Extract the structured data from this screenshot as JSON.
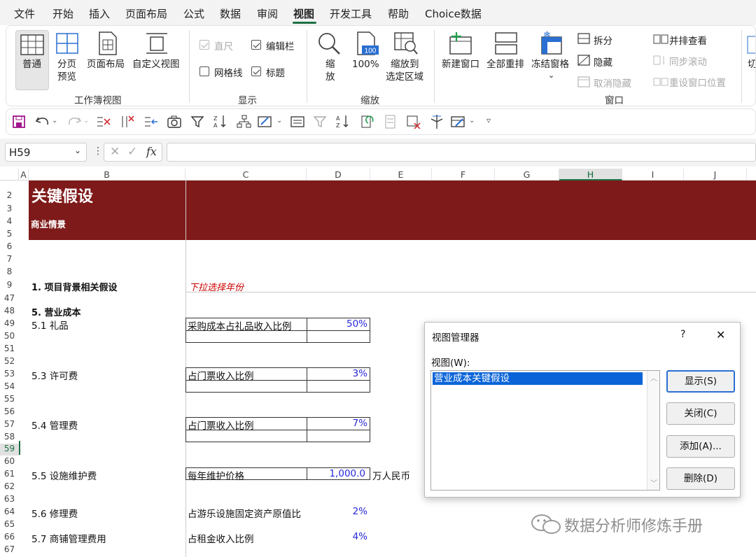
{
  "menu": [
    "文件",
    "开始",
    "插入",
    "页面布局",
    "公式",
    "数据",
    "审阅",
    "视图",
    "开发工具",
    "帮助",
    "Choice数据"
  ],
  "menu_active": "视图",
  "ribbon": {
    "workbook_views": {
      "normal": "普通",
      "page_break_1": "分页",
      "page_break_2": "预览",
      "page_layout": "页面布局",
      "custom_views": "自定义视图",
      "group": "工作簿视图"
    },
    "show": {
      "ruler": "直尺",
      "formula_bar": "编辑栏",
      "gridlines": "网格线",
      "headings": "标题",
      "group": "显示"
    },
    "zoom": {
      "zoom_1": "缩",
      "zoom_2": "放",
      "hundred": "100%",
      "zoom_sel_1": "缩放到",
      "zoom_sel_2": "选定区域",
      "group": "缩放",
      "icon_100": "100"
    },
    "window": {
      "new_window": "新建窗口",
      "arrange_all": "全部重排",
      "freeze_panes": "冻结窗格",
      "split": "拆分",
      "hide": "隐藏",
      "unhide": "取消隐藏",
      "side_by_side": "并排查看",
      "sync_scroll": "同步滚动",
      "reset_pos": "重设窗口位置",
      "group": "窗口",
      "switch": "切"
    }
  },
  "formula_bar": {
    "name_box": "H59",
    "fx": "fx",
    "value": ""
  },
  "columns": [
    "A",
    "B",
    "C",
    "D",
    "E",
    "F",
    "G",
    "H",
    "I",
    "J"
  ],
  "selected_column": "H",
  "rows": [
    "2",
    "3",
    "4",
    "5",
    "6",
    "7",
    "8",
    "9",
    "47",
    "48",
    "49",
    "50",
    "51",
    "52",
    "53",
    "54",
    "55",
    "56",
    "57",
    "58",
    "59",
    "60",
    "61",
    "62",
    "63",
    "64",
    "65",
    "66",
    "67"
  ],
  "selected_row": "59",
  "sheet": {
    "title": "关键假设",
    "subtitle": "商业情景",
    "sec1": "1. 项目背景相关假设",
    "dropdown_hint": "下拉选择年份",
    "sec5": "5. 营业成本",
    "gift": "5.1 礼品",
    "gift_label": "采购成本占礼品收入比例",
    "gift_value": "50%",
    "license": "5.3 许可费",
    "license_label": "占门票收入比例",
    "license_value": "3%",
    "mgmt": "5.4 管理费",
    "mgmt_label": "占门票收入比例",
    "mgmt_value": "7%",
    "maint": "5.5 设施维护费",
    "maint_label": "每年维护价格",
    "maint_value": "1,000.0",
    "maint_unit": "万人民币",
    "repair": "5.6 修理费",
    "repair_label": "占游乐设施固定资产原值比",
    "repair_value": "2%",
    "shop": "5.7 商铺管理费用",
    "shop_label": "占租金收入比例",
    "shop_value": "4%"
  },
  "dialog": {
    "title": "视图管理器",
    "help": "?",
    "close": "✕",
    "list_label": "视图(W):",
    "items": [
      "营业成本关键假设"
    ],
    "show": "显示(S)",
    "close_btn": "关闭(C)",
    "add": "添加(A)...",
    "delete": "删除(D)"
  },
  "watermark": "数据分析师修炼手册",
  "colors": {
    "header_band": "#7f1a1a",
    "excel_green": "#1e7145",
    "input_blue": "#2828d8",
    "selection": "#0a64d8"
  }
}
